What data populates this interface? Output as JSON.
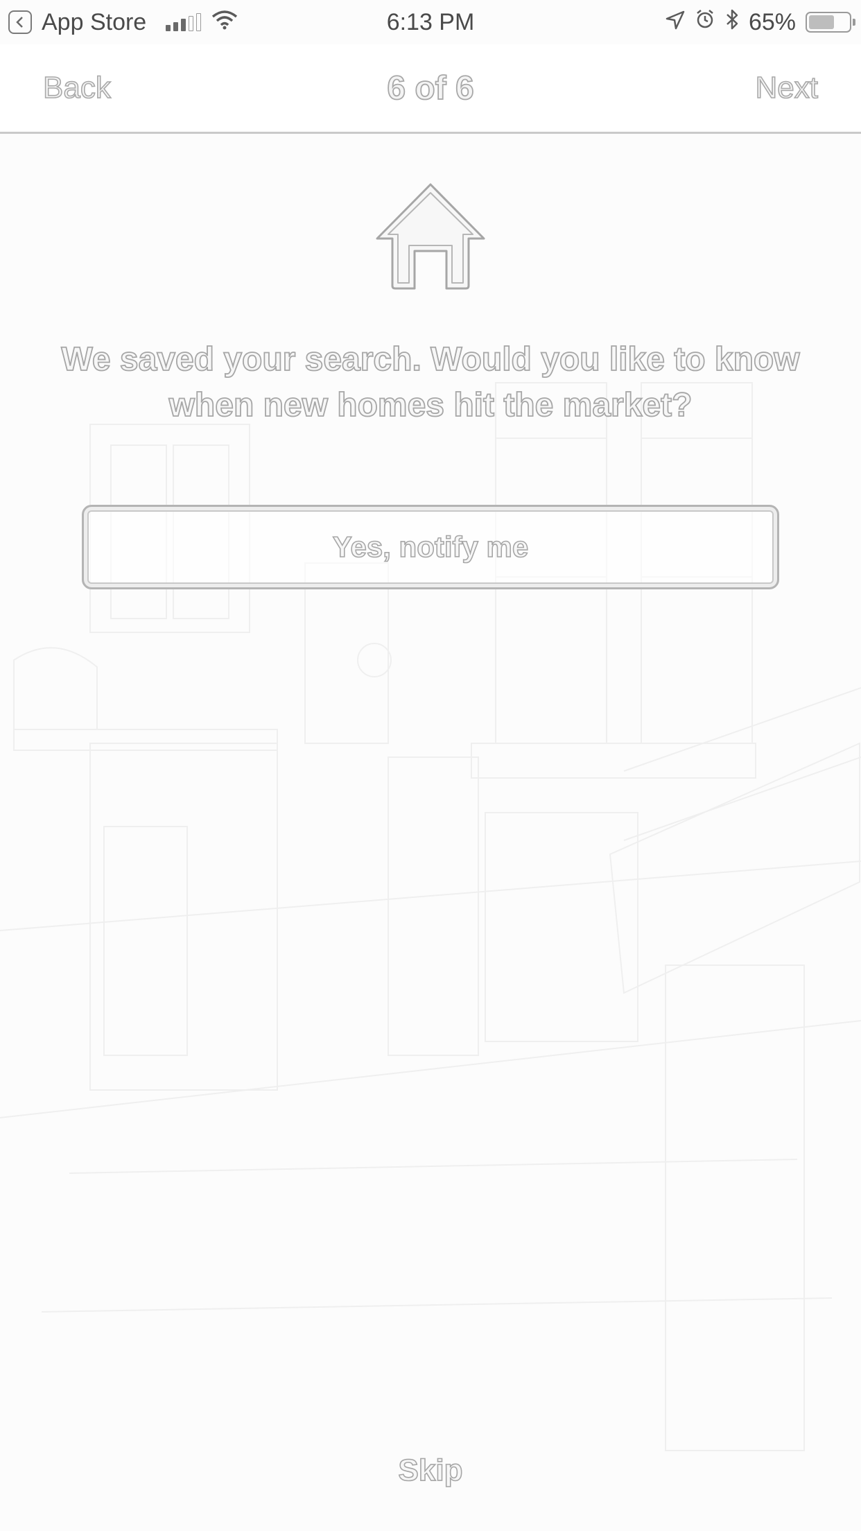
{
  "status_bar": {
    "back_app": "App Store",
    "time": "6:13 PM",
    "battery": "65%",
    "battery_level": 0.65,
    "icons": [
      "back-to-app-icon",
      "cellular-signal-icon",
      "wifi-icon",
      "location-arrow-icon",
      "alarm-icon",
      "bluetooth-icon",
      "battery-icon"
    ]
  },
  "nav": {
    "back_label": "Back",
    "title": "6 of 6",
    "next_label": "Next"
  },
  "main": {
    "icon": "house-icon",
    "prompt": "We saved your search. Would you like to know when new homes hit the market?",
    "notify_label": "Yes, notify me"
  },
  "footer": {
    "skip_label": "Skip"
  },
  "colors": {
    "outline": "#a8a8a8",
    "nav_divider": "#c9c9c9",
    "status_text": "#4a4a4a"
  }
}
